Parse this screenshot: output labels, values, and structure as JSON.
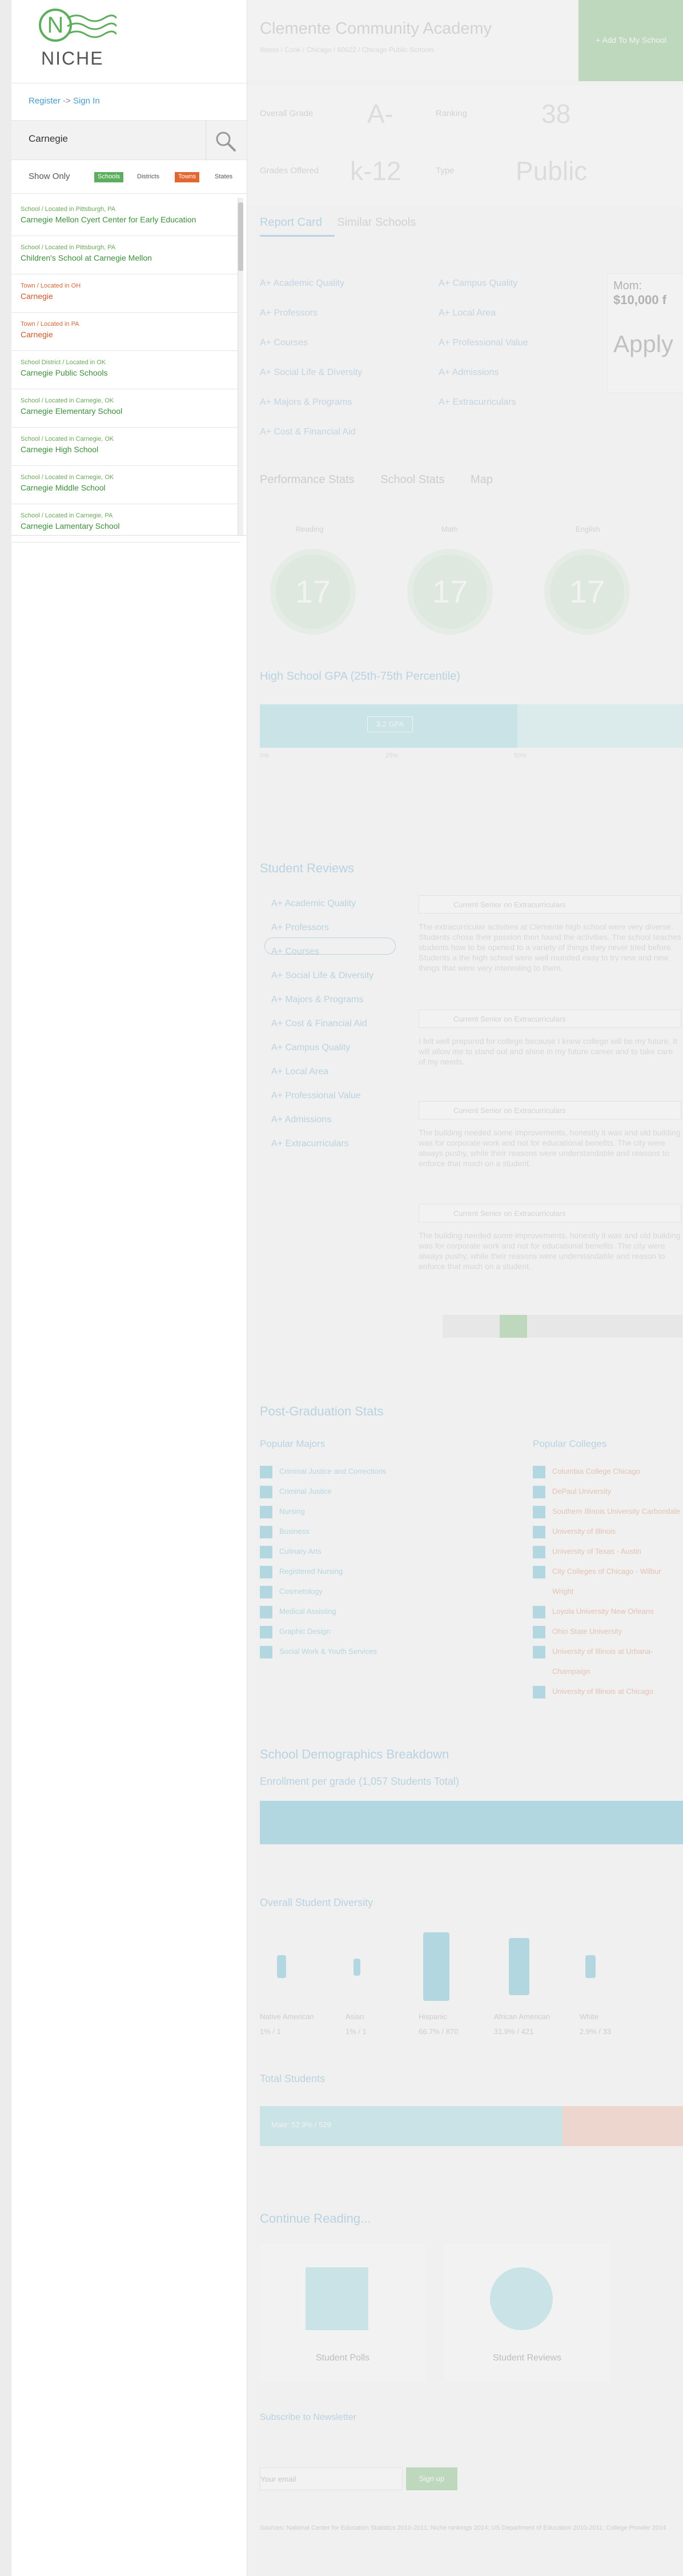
{
  "brand": {
    "wordmark": "NICHE",
    "logo_letter": "N",
    "green": "#5cae5c"
  },
  "auth": {
    "register": "Register",
    "sign_in": "Sign In",
    "arrow": "->"
  },
  "search": {
    "value": "Carnegie"
  },
  "filters": {
    "label": "Show Only",
    "options": [
      {
        "label": "Schools",
        "active": true,
        "color": "#5cae5c"
      },
      {
        "label": "Districts",
        "active": false
      },
      {
        "label": "Towns",
        "active": true,
        "color": "#e0672f"
      },
      {
        "label": "States",
        "active": false
      }
    ]
  },
  "results": [
    {
      "kind": "school",
      "sub": "School / Located in Pittsburgh, PA",
      "title": "Carnegie Mellon Cyert Center for Early Education"
    },
    {
      "kind": "school",
      "sub": "School / Located in Pittsburgh, PA",
      "title": "Children's School at Carnegie Mellon"
    },
    {
      "kind": "town",
      "sub": "Town / Located in OH",
      "title": "Carnegie"
    },
    {
      "kind": "town",
      "sub": "Town / Located in PA",
      "title": "Carnegie"
    },
    {
      "kind": "school",
      "sub": "School District / Located in OK",
      "title": "Carnegie Public Schools"
    },
    {
      "kind": "school",
      "sub": "School / Located in Carnegie, OK",
      "title": "Carnegie Elementary School"
    },
    {
      "kind": "school",
      "sub": "School / Located in Carnegie, OK",
      "title": "Carnegie High School"
    },
    {
      "kind": "school",
      "sub": "School / Located in Carnegie, OK",
      "title": "Carnegie Middle School"
    },
    {
      "kind": "school",
      "sub": "School / Located in Carnegie, PA",
      "title": "Carnegie Lamentary School"
    }
  ],
  "page": {
    "school_name": "Clemente Community Academy",
    "breadcrumb": "Illinois / Cook / Chicago / 60622 / Chicago Public Schools",
    "add_button": "+ Add To My School",
    "stats": [
      {
        "label": "Overall Grade",
        "value": "A-"
      },
      {
        "label": "Ranking",
        "value": "38"
      },
      {
        "label": "Grades Offered",
        "value": "k-12"
      },
      {
        "label": "Type",
        "value": "Public"
      }
    ],
    "tabs": [
      "Report Card",
      "Similar Schools"
    ],
    "report_card_left": [
      "A+ Academic Quality",
      "A+ Professors",
      "A+ Courses",
      "A+ Social Life & Diversity",
      "A+ Majors & Programs",
      "A+ Cost & Financial Aid"
    ],
    "report_card_right": [
      "A+ Campus Quality",
      "A+ Local Area",
      "A+ Professional Value",
      "A+ Admissions",
      "A+ Extracurriculars"
    ],
    "promo": {
      "line1": "Mom:",
      "line2": "$10,000 f",
      "cta": "Apply"
    },
    "stat_tabs": [
      "Performance Stats",
      "School Stats",
      "Map"
    ],
    "scores": [
      {
        "label": "Reading",
        "value": "17"
      },
      {
        "label": "Math",
        "value": "17"
      },
      {
        "label": "English",
        "value": "17"
      }
    ],
    "gpa_title": "High School GPA (25th-75th Percentile)",
    "gpa_tag": "3.2 GPA",
    "gpa_ticks": [
      "0%",
      "25%",
      "50%"
    ],
    "reviews_title": "Student Reviews",
    "review_cats": [
      "A+ Academic Quality",
      "A+ Professors",
      "A+ Courses",
      "A+ Social Life & Diversity",
      "A+ Majors & Programs",
      "A+ Cost & Financial Aid",
      "A+ Campus Quality",
      "A+ Local Area",
      "A+ Professional Value",
      "A+ Admissions",
      "A+ Extracurriculars"
    ],
    "reviews": [
      {
        "q": "Current Senior on Extracurriculars",
        "body": "The extracurricular activities at Clemente high school were very diverse. Students chose their passion then found the activities. The school teaches students how to be opened to a variety of things they never tried before. Students a the high school were well rounded easy to try new and new things that were very interesting to them."
      },
      {
        "q": "Current Senior on Extracurriculars",
        "body": "I felt well prepared for college because I knew college will be my future. It will allow me to stand out and shine in my future career and to take care of my needs."
      },
      {
        "q": "Current Senior on Extracurriculars",
        "body": "The building needed some improvements, honestly it was and old building was for corporate work and not for educational benefits. The city were always pushy, while their reasons were understandable and reasons to enforce that much on a student."
      },
      {
        "q": "Current Senior on Extracurriculars",
        "body": "The building needed some improvements, honestly it was and old building was for corporate work and not for educational benefits. The city were always pushy, while their reasons were understandable and reason to enforce that much on a student."
      }
    ],
    "post_grad_title": "Post-Graduation Stats",
    "majors_title": "Popular Majors",
    "colleges_title": "Popular Colleges",
    "majors": [
      "Criminal Justice and Corrections",
      "Criminal Justice",
      "Nursing",
      "Business",
      "Culinary Arts",
      "Registered Nursing",
      "Cosmetology",
      "Medical Assisting",
      "Graphic Design",
      "Social Work & Youth Services"
    ],
    "colleges": [
      "Columbia College Chicago",
      "DePaul University",
      "Southern Illinois University Carbondale",
      "University of Illinois",
      "University of Texas - Austin",
      "City Colleges of Chicago - Wilbur Wright",
      "Loyola University New Orleans",
      "Ohio State University",
      "University of Illinois at Urbana-Champaign",
      "University of Illinois at Chicago"
    ],
    "demo_title": "School Demographics Breakdown",
    "enroll_title": "Enrollment per grade (1,057 Students Total)",
    "diversity_title": "Overall Student Diversity",
    "diversity": [
      {
        "label": "Native American",
        "value": "1% / 1"
      },
      {
        "label": "Asian",
        "value": "1% / 1"
      },
      {
        "label": "Hispanic",
        "value": "66.7% / 870"
      },
      {
        "label": "African American",
        "value": "31.9% / 421"
      },
      {
        "label": "White",
        "value": "2.9% / 33"
      }
    ],
    "total_title": "Total Students",
    "total_male": "Male: 52.9% / 529",
    "continue_title": "Continue Reading...",
    "cards": [
      "Student Polls",
      "Student Reviews"
    ],
    "newsletter_title": "Subscribe to Newsletter",
    "email_placeholder": "Your email",
    "signup": "Sign up",
    "footer": "Sources: National Center for Education Statistics 2010-2011; Niche rankings 2014; US Department of Education 2010-2011; College Prowler 2014"
  }
}
